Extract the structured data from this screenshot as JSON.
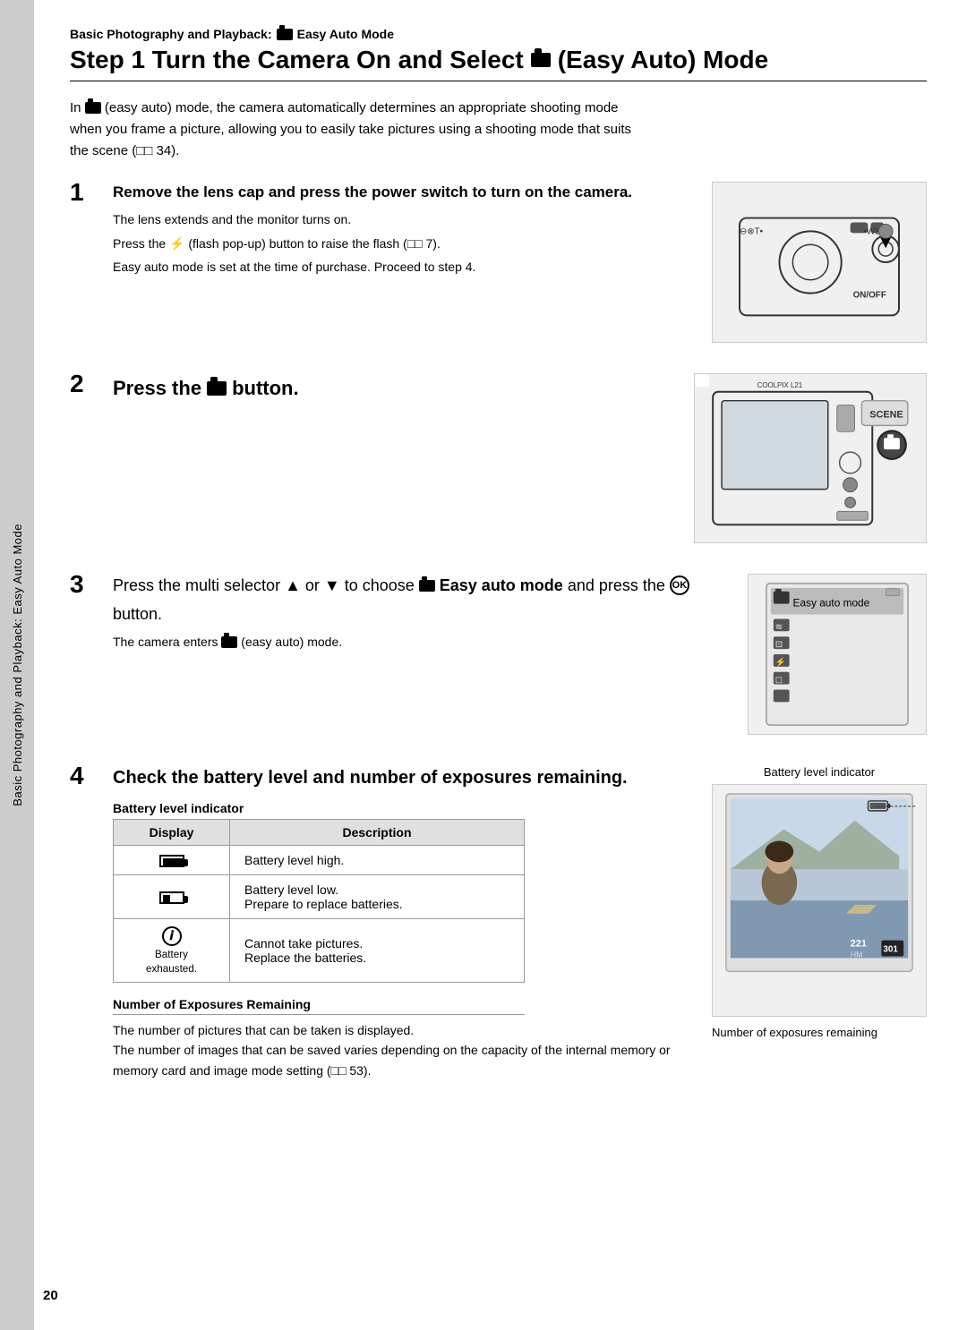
{
  "header": {
    "breadcrumb": "Basic Photography and Playback:",
    "breadcrumb_icon": "camera",
    "breadcrumb_suffix": "Easy Auto Mode",
    "title_prefix": "Step 1 Turn the Camera On and Select",
    "title_icon": "camera",
    "title_suffix": "(Easy Auto) Mode"
  },
  "intro": {
    "text": "In  (easy auto) mode, the camera automatically determines an appropriate shooting mode when you frame a picture, allowing you to easily take pictures using a shooting mode that suits the scene (□□ 34)."
  },
  "steps": [
    {
      "number": "1",
      "heading": "Remove the lens cap and press the power switch to turn on the camera.",
      "details": [
        "The lens extends and the monitor turns on.",
        "Press the ⚡ (flash pop-up) button to raise the flash (□□ 7).",
        "Easy auto mode is set at the time of purchase. Proceed to step 4."
      ]
    },
    {
      "number": "2",
      "heading": "Press the",
      "heading_suffix": "button."
    },
    {
      "number": "3",
      "heading_prefix": "Press the multi selector ▲ or ▼ to choose",
      "heading_bold": "Easy auto mode",
      "heading_middle": "and press the",
      "heading_suffix": "button.",
      "detail": "The camera enters  (easy auto) mode."
    },
    {
      "number": "4",
      "heading": "Check the battery level and number of exposures remaining.",
      "battery_label": "Battery level indicator",
      "table": {
        "headers": [
          "Display",
          "Description"
        ],
        "rows": [
          {
            "display_type": "battery_high",
            "description": "Battery level high."
          },
          {
            "display_type": "battery_low",
            "description": "Battery level low.\nPrepare to replace batteries."
          },
          {
            "display_type": "info",
            "display_label": "Battery\nexhausted.",
            "description": "Cannot take pictures.\nReplace the batteries."
          }
        ]
      },
      "exposures_heading": "Number of Exposures Remaining",
      "exposures_text": [
        "The number of pictures that can be taken is displayed.",
        "The number of images that can be saved varies depending on the capacity of the internal memory or memory card and image mode setting (□□ 53)."
      ],
      "image_label_top": "Battery level indicator",
      "image_label_bottom": "Number of exposures remaining"
    }
  ],
  "side_tab": {
    "text": "Basic Photography and Playback:  Easy Auto Mode"
  },
  "page_number": "20"
}
